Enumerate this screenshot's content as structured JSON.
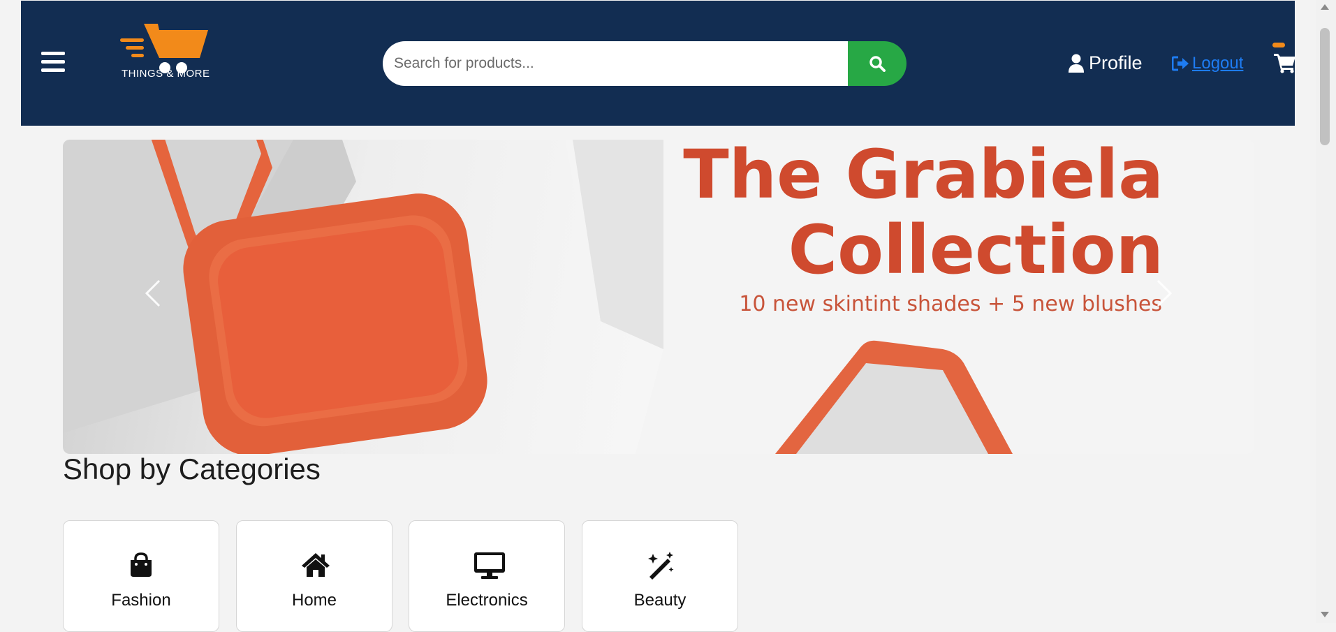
{
  "header": {
    "brand": "THINGS & MORE",
    "search": {
      "placeholder": "Search for products...",
      "value": ""
    },
    "profile_label": "Profile",
    "logout_label": "Logout",
    "cart_icon": "cart-icon",
    "colors": {
      "header_bg": "#122d52",
      "search_button": "#27a845",
      "logo_orange": "#f28a1a",
      "link": "#1e7cf2"
    }
  },
  "banner": {
    "title_line1": "The Grabiela",
    "title_line2": "Collection",
    "subtitle": "10 new skintint shades + 5 new blushes",
    "text_color": "#cf4a2e"
  },
  "categories": {
    "title": "Shop by Categories",
    "items": [
      {
        "label": "Fashion",
        "icon": "shopping-bag-icon"
      },
      {
        "label": "Home",
        "icon": "home-icon"
      },
      {
        "label": "Electronics",
        "icon": "desktop-icon"
      },
      {
        "label": "Beauty",
        "icon": "magic-wand-icon"
      }
    ]
  }
}
